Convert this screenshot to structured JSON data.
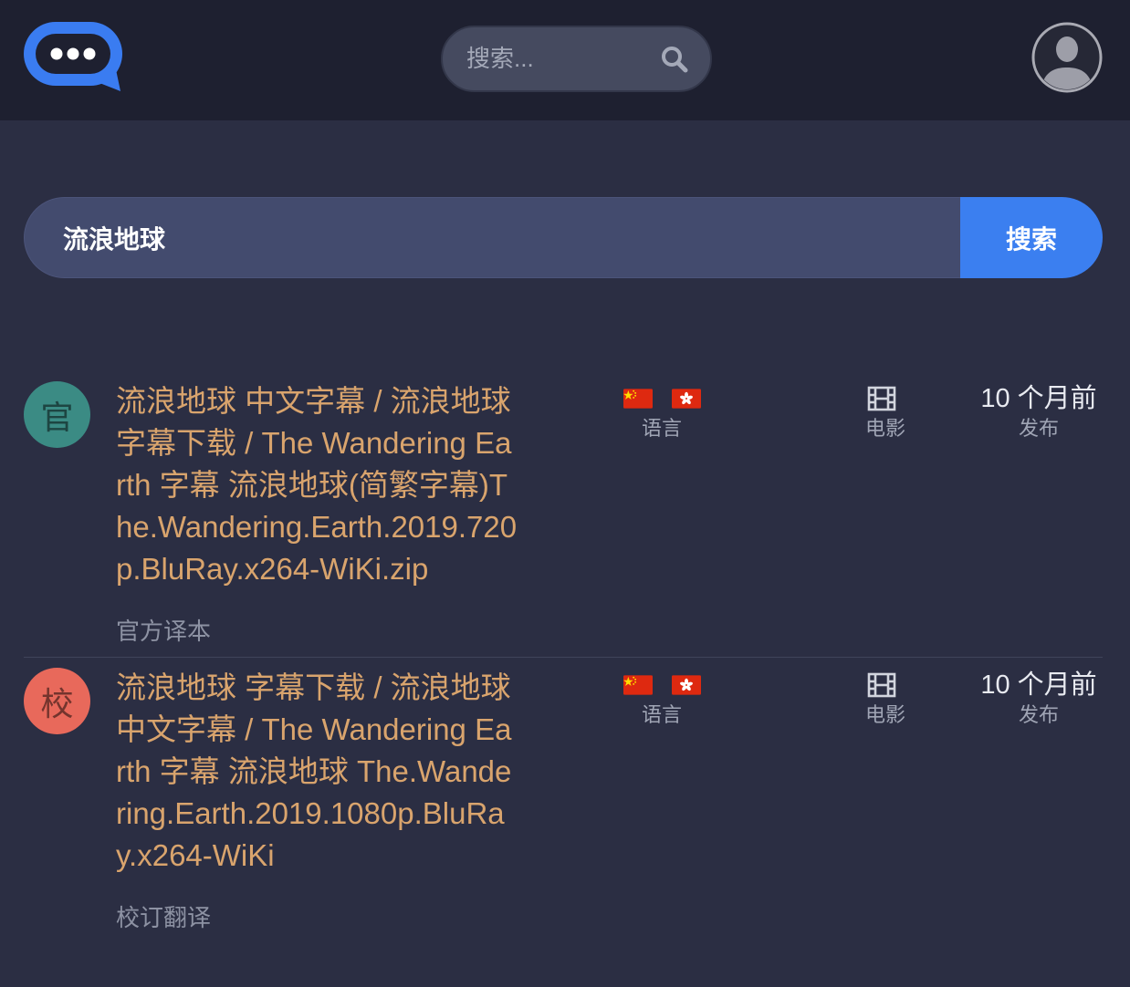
{
  "header": {
    "logo_icon": "chat-bubble-logo-icon",
    "search_placeholder": "搜索...",
    "search_icon": "search-icon",
    "avatar_icon": "user-avatar-icon"
  },
  "search": {
    "query": "流浪地球",
    "button_label": "搜索"
  },
  "results": [
    {
      "badge": "官",
      "badge_color": "#3b8b84",
      "title": "流浪地球 中文字幕 / 流浪地球 字幕下载 / The Wandering Earth 字幕 流浪地球(简繁字幕)The.Wandering.Earth.2019.720p.BluRay.x264-WiKi.zip",
      "subtitle": "官方译本",
      "language_flags": [
        "china-flag-icon",
        "hong-kong-flag-icon"
      ],
      "language_label": "语言",
      "category_icon": "film-icon",
      "category_label": "电影",
      "time": "10 个月前",
      "time_label": "发布"
    },
    {
      "badge": "校",
      "badge_color": "#e8695b",
      "title": "流浪地球 字幕下载 / 流浪地球 中文字幕 / The Wandering Earth 字幕 流浪地球 The.Wandering.Earth.2019.1080p.BluRay.x264-WiKi",
      "subtitle": "校订翻译",
      "language_flags": [
        "china-flag-icon",
        "hong-kong-flag-icon"
      ],
      "language_label": "语言",
      "category_icon": "film-icon",
      "category_label": "电影",
      "time": "10 个月前",
      "time_label": "发布"
    }
  ],
  "colors": {
    "header_bg": "#1e2030",
    "page_bg": "#2b2e43",
    "accent": "#3b7ff0",
    "title": "#d9a46d",
    "muted": "#a0a5b5"
  }
}
